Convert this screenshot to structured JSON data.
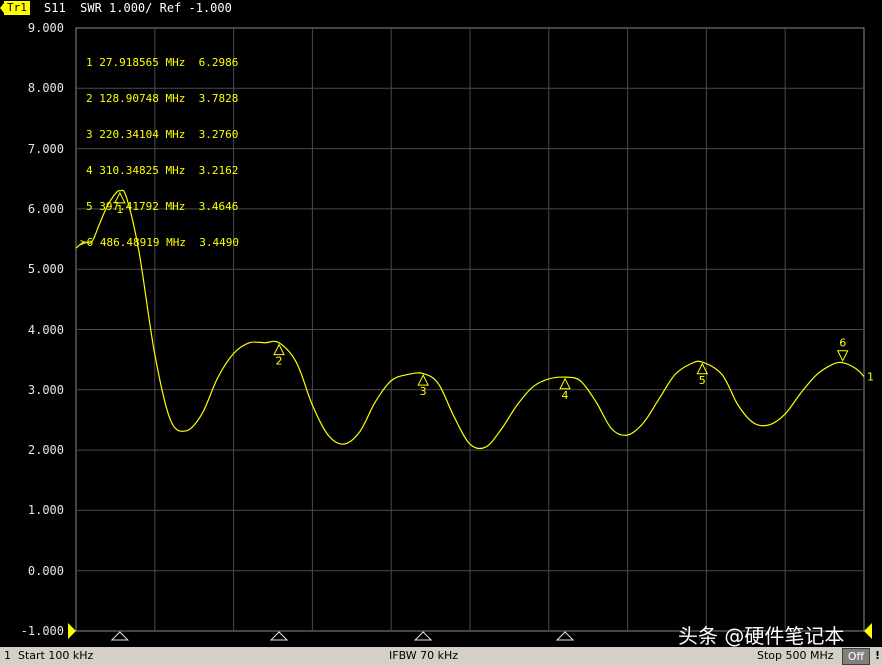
{
  "header": {
    "trace_tag": "Tr1",
    "measurement": "S11  SWR 1.000/ Ref -1.000"
  },
  "marker_table": [
    {
      "id": "1",
      "freq": "27.918565 MHz",
      "value": "6.2986"
    },
    {
      "id": "2",
      "freq": "128.90748 MHz",
      "value": "3.7828"
    },
    {
      "id": "3",
      "freq": "220.34104 MHz",
      "value": "3.2760"
    },
    {
      "id": "4",
      "freq": "310.34825 MHz",
      "value": "3.2162"
    },
    {
      "id": "5",
      "freq": "397.41792 MHz",
      "value": "3.4646"
    },
    {
      "id": ">6",
      "freq": "486.48919 MHz",
      "value": "3.4490"
    }
  ],
  "status_bar": {
    "channel": "1",
    "start": "Start 100 kHz",
    "ifbw": "IFBW 70 kHz",
    "stop": "Stop 500 MHz",
    "off": "Off",
    "alert": "!"
  },
  "watermark": "头条 @硬件笔记本",
  "colors": {
    "trace": "#ffff00",
    "grid": "#4a4a4a",
    "background": "#000000",
    "status_bar": "#d4d0c8"
  },
  "chart_data": {
    "type": "line",
    "title": "S11  SWR 1.000/ Ref -1.000",
    "xlabel": "",
    "ylabel": "",
    "xlim": [
      0.1,
      500
    ],
    "ylim": [
      -1,
      9
    ],
    "y_ticks": [
      "9.000",
      "8.000",
      "7.000",
      "6.000",
      "5.000",
      "4.000",
      "3.000",
      "2.000",
      "1.000",
      "0.000",
      "-1.000"
    ],
    "grid": true,
    "series": [
      {
        "name": "S11",
        "x": [
          0.1,
          5,
          10,
          15,
          20,
          25,
          27.9,
          32,
          40,
          50,
          60,
          70,
          80,
          90,
          100,
          110,
          120,
          128.9,
          140,
          150,
          160,
          170,
          180,
          190,
          200,
          210,
          220.3,
          230,
          240,
          250,
          260,
          270,
          280,
          290,
          300,
          310.3,
          320,
          330,
          340,
          350,
          360,
          370,
          380,
          390,
          397.4,
          410,
          420,
          430,
          440,
          450,
          460,
          470,
          480,
          486.5,
          495,
          500
        ],
        "y": [
          5.35,
          5.45,
          5.45,
          5.75,
          6.05,
          6.25,
          6.3,
          6.2,
          5.3,
          3.6,
          2.5,
          2.32,
          2.6,
          3.2,
          3.6,
          3.78,
          3.78,
          3.78,
          3.45,
          2.75,
          2.25,
          2.1,
          2.3,
          2.8,
          3.15,
          3.25,
          3.27,
          3.1,
          2.55,
          2.1,
          2.05,
          2.35,
          2.75,
          3.05,
          3.18,
          3.21,
          3.15,
          2.8,
          2.35,
          2.25,
          2.45,
          2.85,
          3.25,
          3.43,
          3.46,
          3.25,
          2.75,
          2.45,
          2.42,
          2.6,
          2.95,
          3.25,
          3.42,
          3.45,
          3.35,
          3.22
        ]
      }
    ],
    "markers": [
      {
        "label": "1",
        "x": 27.918565,
        "y": 6.2986
      },
      {
        "label": "2",
        "x": 128.90748,
        "y": 3.7828
      },
      {
        "label": "3",
        "x": 220.34104,
        "y": 3.276
      },
      {
        "label": "4",
        "x": 310.34825,
        "y": 3.2162
      },
      {
        "label": "5",
        "x": 397.41792,
        "y": 3.4646
      },
      {
        "label": "6",
        "x": 486.48919,
        "y": 3.449
      }
    ],
    "reference_label": "1"
  }
}
